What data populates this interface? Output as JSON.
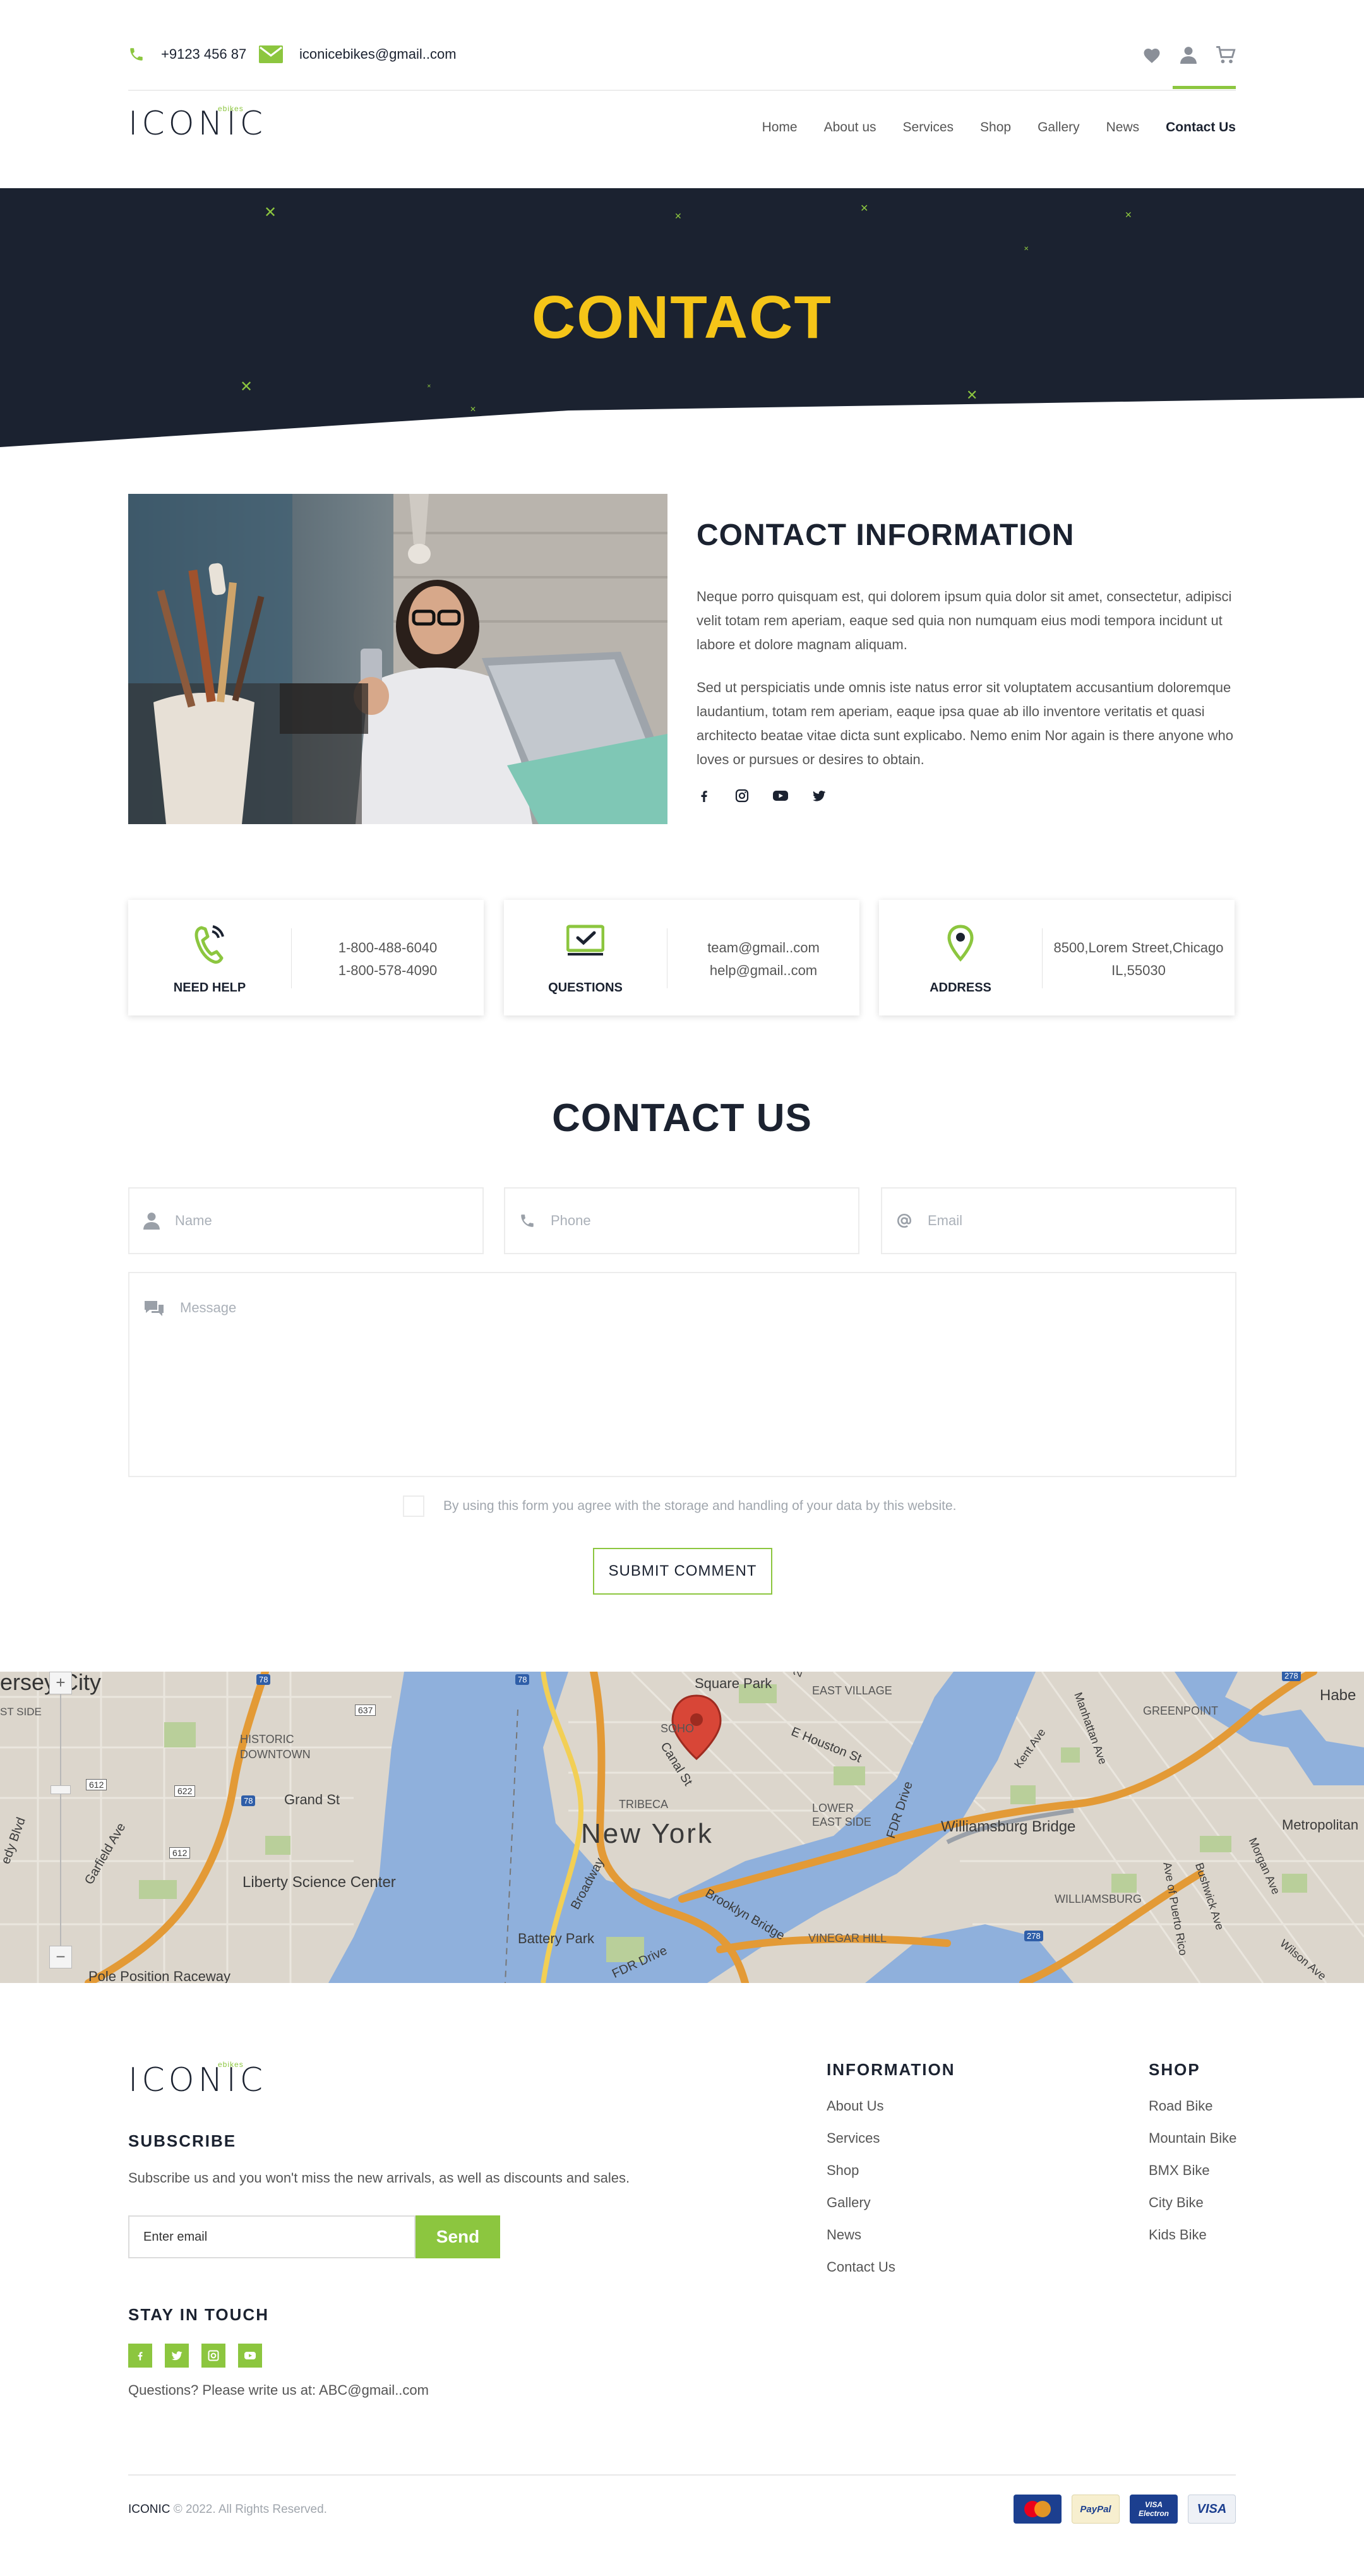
{
  "topbar": {
    "phone": "+9123 456 87",
    "email": "iconicebikes@gmail..com"
  },
  "logo": {
    "main": "ICONIC",
    "sup": "ebikes"
  },
  "nav": {
    "items": [
      "Home",
      "About us",
      "Services",
      "Shop",
      "Gallery",
      "News",
      "Contact Us"
    ]
  },
  "hero": {
    "title": "CONTACT"
  },
  "contact_info": {
    "title": "CONTACT INFORMATION",
    "p1": "Neque porro quisquam est, qui dolorem ipsum quia dolor sit amet, consectetur, adipisci velit totam rem aperiam, eaque sed quia non numquam eius modi tempora incidunt ut labore et dolore magnam aliquam.",
    "p2": "Sed ut perspiciatis unde omnis iste natus error sit voluptatem accusantium doloremque laudantium, totam rem aperiam, eaque ipsa quae ab illo inventore veritatis et quasi architecto beatae vitae dicta sunt explicabo. Nemo enim Nor again is there anyone who loves or pursues or desires to obtain.",
    "socials": [
      "facebook-icon",
      "instagram-icon",
      "youtube-icon",
      "twitter-icon"
    ]
  },
  "cards": [
    {
      "label": "NEED HELP",
      "icon": "phone-icon",
      "lines": [
        "1-800-488-6040",
        "1-800-578-4090"
      ]
    },
    {
      "label": "QUESTIONS",
      "icon": "mail-check-icon",
      "lines": [
        "team@gmail..com",
        "help@gmail..com"
      ]
    },
    {
      "label": "ADDRESS",
      "icon": "map-pin-icon",
      "lines": [
        "8500,Lorem Street,Chicago",
        "IL,55030"
      ]
    }
  ],
  "contact_us": {
    "title": "CONTACT US",
    "name_placeholder": "Name",
    "phone_placeholder": "Phone",
    "email_placeholder": "Email",
    "message_placeholder": "Message",
    "agree": "By using this form you agree with the storage and handling of your data by this website.",
    "submit": "SUBMIT COMMENT"
  },
  "map": {
    "labels": {
      "city": "New York",
      "williamsburg_bridge": "Williamsburg Bridge",
      "liberty": "Liberty Science Center",
      "battery": "Battery Park",
      "tribeca": "TRIBECA",
      "soho": "SOHO",
      "square_park": "Square Park",
      "east_village": "EAST VILLAGE",
      "lower_east": "LOWER EAST SIDE",
      "historic": "HISTORIC DOWNTOWN",
      "greenpoint": "GREENPOINT",
      "williamsburg": "WILLIAMSBURG",
      "vinegar_hill": "VINEGAR HILL",
      "grand_st": "Grand St",
      "e_houston": "E Houston St",
      "canal_st": "Canal St",
      "broadway": "Broadway",
      "fdr_drive": "FDR Drive",
      "brooklyn_bridge": "Brooklyn Bridge",
      "metropolitan": "Metropolitan",
      "habe": "Habe",
      "city_partial": "ersey City",
      "garfield": "Garfield Ave",
      "pole": "Pole Position Raceway",
      "kent": "Kent Ave",
      "manhattan_ave": "Manhattan Ave",
      "bushwick": "Bushwick Ave",
      "morgan": "Morgan Ave",
      "wilson": "Wilson Ave",
      "puerto": "Ave of Puerto Rico",
      "second_ave": "2nd",
      "east_side": "ST SIDE",
      "ridy": "edy Blvd"
    },
    "shields": [
      "78",
      "78",
      "78",
      "637",
      "612",
      "622",
      "612",
      "278",
      "278"
    ],
    "zoom_in": "+",
    "zoom_out": "−"
  },
  "footer": {
    "subscribe_title": "SUBSCRIBE",
    "subscribe_text": "Subscribe us and you won't miss the new arrivals, as well as discounts and sales.",
    "email_placeholder": "Enter email",
    "send": "Send",
    "stay_title": "STAY IN TOUCH",
    "questions": "Questions? Please write us at: ABC@gmail..com",
    "info_title": "INFORMATION",
    "info_links": [
      "About Us",
      "Services",
      "Shop",
      "Gallery",
      "News",
      "Contact Us"
    ],
    "shop_title": "SHOP",
    "shop_links": [
      "Road Bike",
      "Mountain Bike",
      "BMX Bike",
      "City Bike",
      "Kids Bike"
    ],
    "copyright_brand": "ICONIC",
    "copyright_rest": "© 2022. All Rights Reserved.",
    "payments": [
      "MasterCard",
      "PayPal",
      "VISA Electron",
      "VISA"
    ]
  },
  "colors": {
    "accent": "#8cc63f",
    "dark": "#1b2230",
    "hero_title": "#f5c518"
  }
}
